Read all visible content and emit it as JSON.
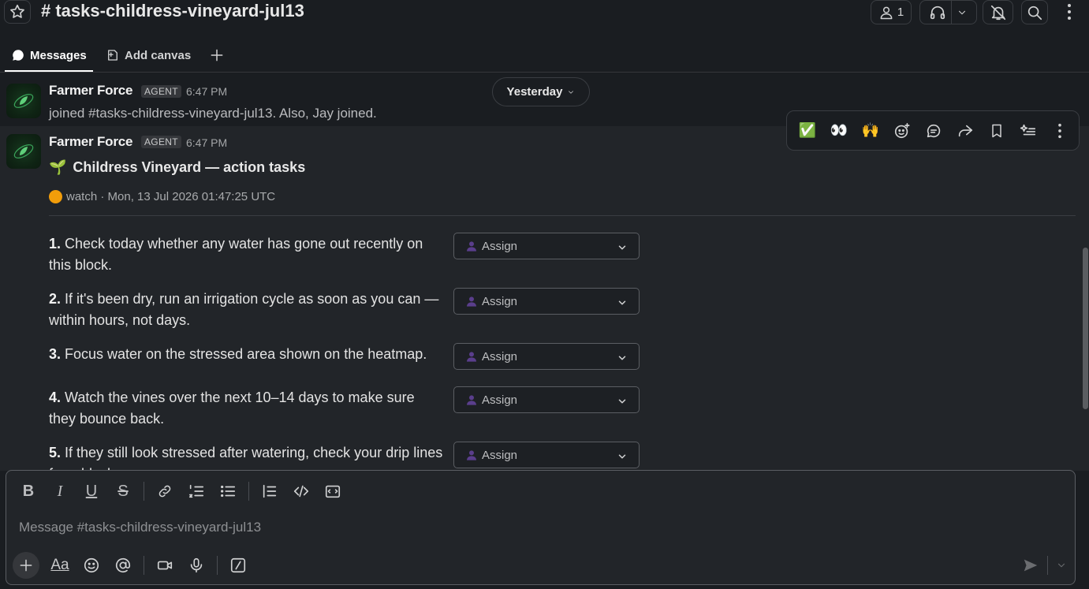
{
  "header": {
    "channel_title": "# tasks-childress-vineyard-jul13",
    "member_count": "1"
  },
  "tabs": {
    "messages_label": "Messages",
    "canvas_label": "Add canvas"
  },
  "date_divider": "Yesterday",
  "message1": {
    "sender": "Farmer Force",
    "badge": "AGENT",
    "time": "6:47 PM",
    "text": "joined #tasks-childress-vineyard-jul13. Also, Jay joined."
  },
  "message2": {
    "sender": "Farmer Force",
    "badge": "AGENT",
    "time": "6:47 PM",
    "title_emoji": "🌱",
    "title": "Childress Vineyard — action tasks",
    "status": "watch · Mon, 13 Jul 2026 01:47:25 UTC",
    "tasks": [
      {
        "num": "1.",
        "text": " Check today whether any water has gone out recently on this block.",
        "assign": "Assign"
      },
      {
        "num": "2.",
        "text": " If it's been dry, run an irrigation cycle as soon as you can — within hours, not days.",
        "assign": "Assign"
      },
      {
        "num": "3.",
        "text": " Focus water on the stressed area shown on the heatmap.",
        "assign": "Assign"
      },
      {
        "num": "4.",
        "text": " Watch the vines over the next 10–14 days to make sure they bounce back.",
        "assign": "Assign"
      },
      {
        "num": "5.",
        "text": " If they still look stressed after watering, check your drip lines for a blockage.",
        "assign": "Assign"
      }
    ]
  },
  "hover_toolbar": {
    "check_emoji": "✅",
    "eyes_emoji": "👀",
    "raised_hands_emoji": "🙌"
  },
  "composer": {
    "placeholder": "Message #tasks-childress-vineyard-jul13",
    "font_label": "Aa"
  },
  "colors": {
    "background": "#1a1d21",
    "status_orange": "#f29d0a",
    "assign_icon": "#5a3e8c"
  }
}
